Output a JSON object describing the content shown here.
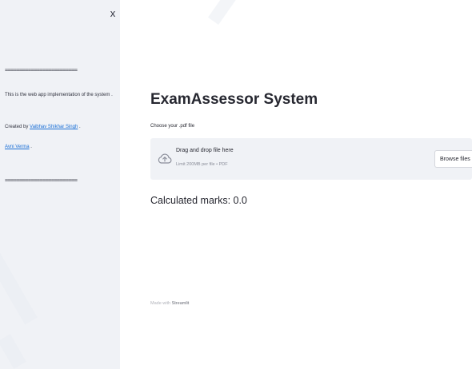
{
  "sidebar": {
    "close_label": "x",
    "divider": "=========================",
    "description": "This is the web app implementation of the system .",
    "created_by_prefix": "Created by",
    "author1": "Vaibhav Shikhar Singh",
    "author1_suffix": " .",
    "author2": "Avni Verma",
    "author2_suffix": " ."
  },
  "main": {
    "title": "ExamAssessor System",
    "uploader": {
      "label": "Choose your .pdf file",
      "drop_text": "Drag and drop file here",
      "limit_text": "Limit 200MB per file • PDF",
      "browse_label": "Browse files"
    },
    "marks_text": "Calculated marks: 0.0",
    "footer": {
      "prefix": "Made with",
      "link": "Streamlit"
    }
  },
  "icons": {
    "upload": "cloud-upload-icon",
    "close": "close-icon"
  },
  "colors": {
    "sidebar_bg": "#f0f2f6",
    "link": "#1a6fd6",
    "text": "#262730"
  }
}
